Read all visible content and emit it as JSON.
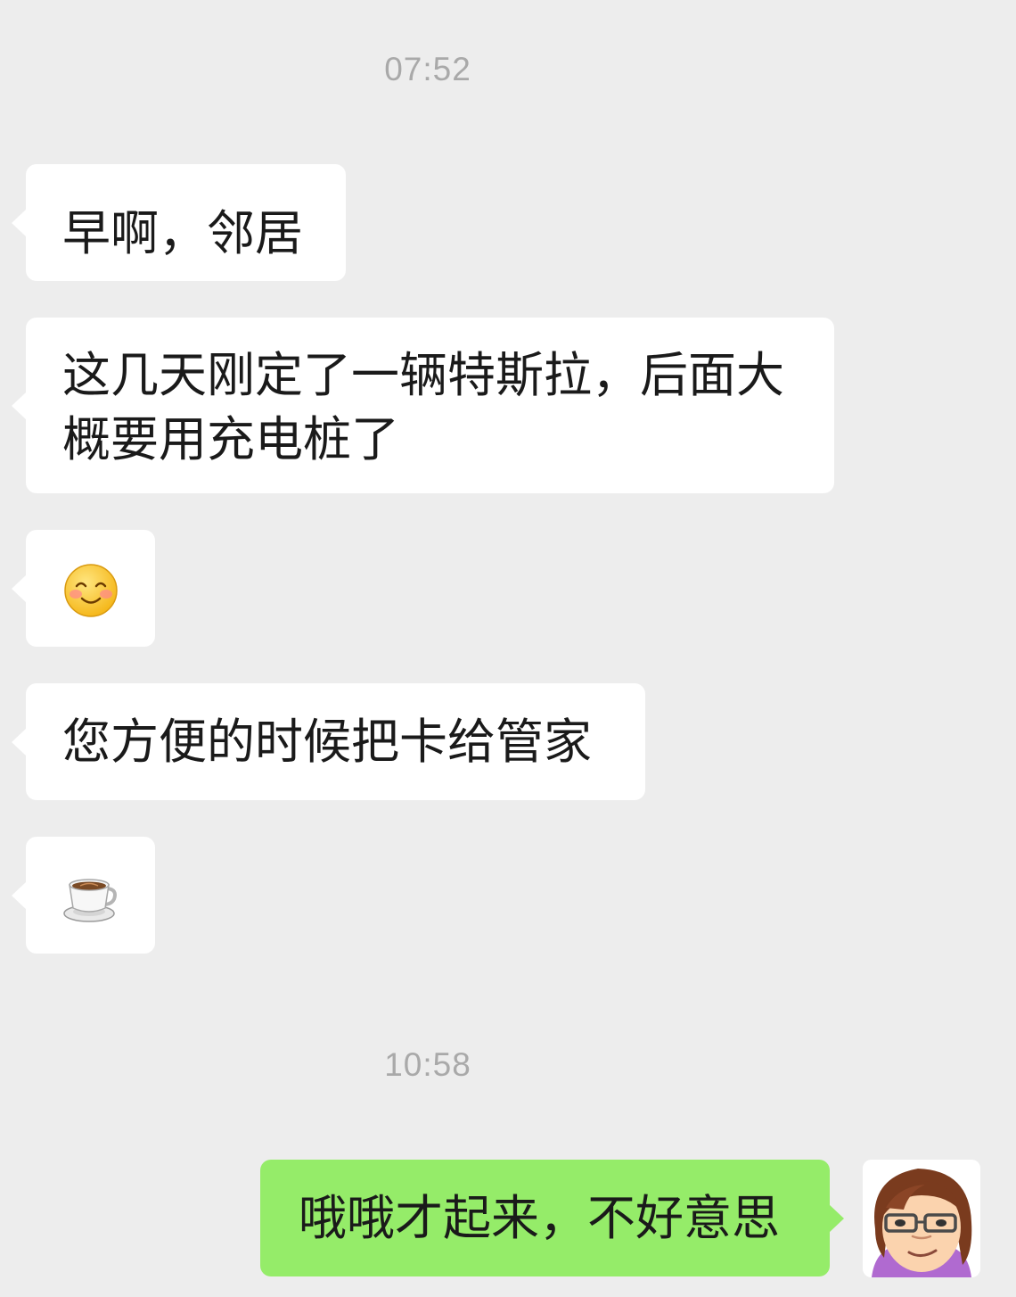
{
  "chat": {
    "timestamps": [
      "07:52",
      "10:58"
    ],
    "messages": [
      {
        "sender": "contact",
        "type": "text",
        "text": "早啊，邻居"
      },
      {
        "sender": "contact",
        "type": "text",
        "text": "这几天刚定了一辆特斯拉，后面大\n概要用充电桩了"
      },
      {
        "sender": "contact",
        "type": "emoji",
        "icon": "blush-smile-emoji"
      },
      {
        "sender": "contact",
        "type": "text",
        "text": "您方便的时候把卡给管家"
      },
      {
        "sender": "contact",
        "type": "emoji",
        "icon": "coffee-cup-emoji"
      },
      {
        "sender": "me",
        "type": "text",
        "text": "哦哦才起来，不好意思"
      }
    ]
  },
  "colors": {
    "background": "#ededed",
    "incoming_bubble": "#ffffff",
    "outgoing_bubble": "#95ec69",
    "timestamp": "#a9a9a9"
  },
  "avatar": {
    "icon": "user-avatar-icon"
  }
}
